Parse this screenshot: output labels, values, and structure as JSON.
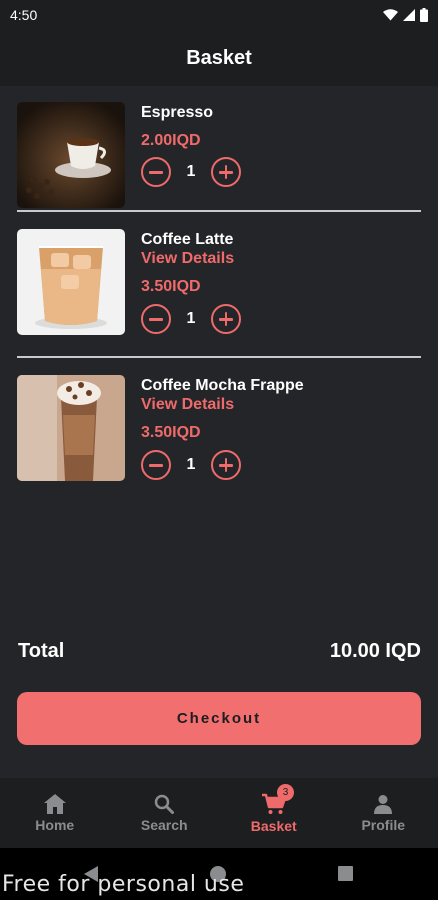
{
  "status_bar": {
    "time": "4:50",
    "icons": [
      "wifi-icon",
      "cell-signal-icon",
      "battery-icon"
    ]
  },
  "header": {
    "title": "Basket"
  },
  "items": [
    {
      "name": "Espresso",
      "link": "",
      "price": "2.00IQD",
      "quantity": "1",
      "image": "espresso-cup-photo"
    },
    {
      "name": "Coffee Latte",
      "link": "View Details",
      "price": "3.50IQD",
      "quantity": "1",
      "image": "iced-latte-photo"
    },
    {
      "name": "Coffee Mocha Frappe",
      "link": "View Details",
      "price": "3.50IQD",
      "quantity": "1",
      "image": "mocha-frappe-photo"
    }
  ],
  "summary": {
    "total_label": "Total",
    "total_value": "10.00 IQD"
  },
  "checkout_label": "Checkout",
  "nav": {
    "items": [
      {
        "label": "Home",
        "icon": "home-icon"
      },
      {
        "label": "Search",
        "icon": "search-icon"
      },
      {
        "label": "Basket",
        "icon": "cart-icon",
        "badge": "3",
        "active": true
      },
      {
        "label": "Profile",
        "icon": "person-icon"
      }
    ]
  },
  "watermark": "Free for personal use",
  "colors": {
    "accent": "#ef6b6b",
    "background": "#242529",
    "bar": "#1d1e20"
  }
}
